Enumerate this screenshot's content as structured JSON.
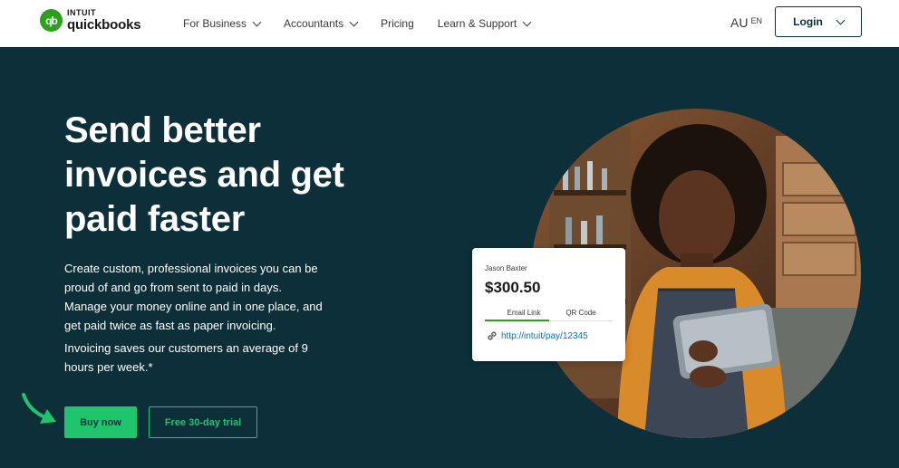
{
  "brand": {
    "intuit": "INTUIT",
    "product": "quickbooks",
    "mark": "qb",
    "color": "#2ca01c"
  },
  "nav": {
    "items": [
      {
        "label": "For Business",
        "dropdown": true
      },
      {
        "label": "Accountants",
        "dropdown": true
      },
      {
        "label": "Pricing",
        "dropdown": false
      },
      {
        "label": "Learn & Support",
        "dropdown": true
      }
    ]
  },
  "locale": {
    "country": "AU",
    "language": "EN"
  },
  "login": {
    "label": "Login"
  },
  "hero": {
    "title": "Send better invoices and get paid faster",
    "description": "Create custom, professional invoices you can be proud of and go from sent to paid in days. Manage your money online and in one place, and get paid twice as fast as paper invoicing.",
    "stat": "Invoicing saves our customers an average of 9 hours per week.*",
    "buy_label": "Buy now",
    "trial_label": "Free 30-day trial",
    "accent": "#1fc46c",
    "background": "#0d2f3a"
  },
  "invoice_card": {
    "customer": "Jason Baxter",
    "amount": "$300.50",
    "tabs": [
      "Email Link",
      "QR Code"
    ],
    "active_tab": "Email Link",
    "link": "http://intuit/pay/12345",
    "link_icon": "link-icon"
  },
  "icons": {
    "dropdown": "chevron-down-icon",
    "arrow": "pointer-arrow-icon"
  }
}
